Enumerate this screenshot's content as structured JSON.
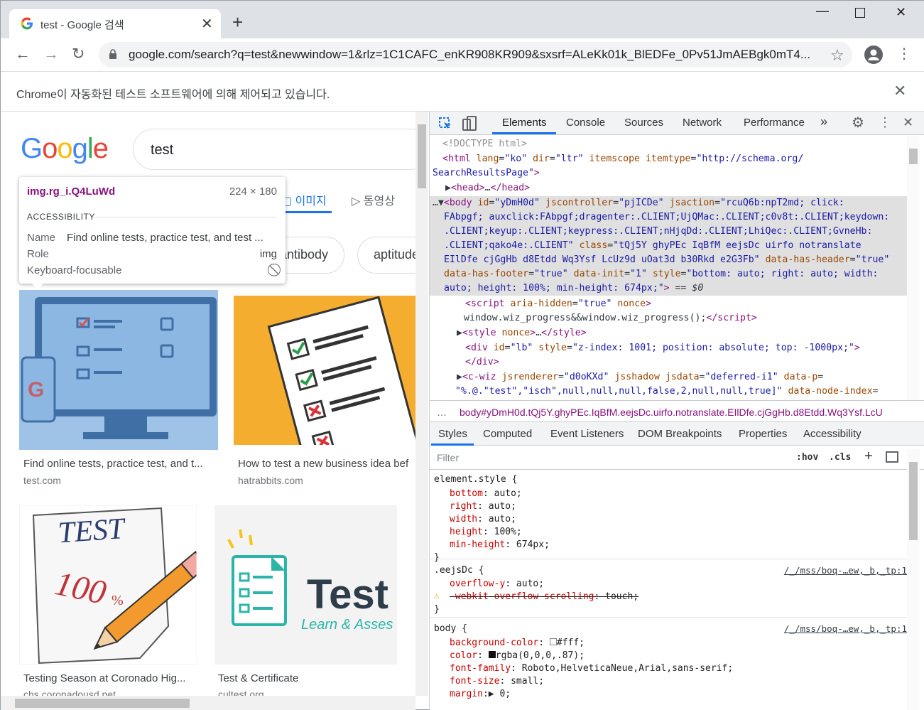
{
  "browser": {
    "tab_title": "test - Google 검색",
    "url": "google.com/search?q=test&newwindow=1&rlz=1C1CAFC_enKR908KR909&sxsrf=ALeKk01k_BlEDFe_0Pv51JmAEBgk0mT4...",
    "infobar_text": "Chrome이 자동화된 테스트 소프트웨어에 의해 제어되고 있습니다."
  },
  "page": {
    "logo_letters": [
      "G",
      "o",
      "o",
      "g",
      "l",
      "e"
    ],
    "logo_colors": [
      "#4285F4",
      "#EA4335",
      "#FBBC05",
      "#4285F4",
      "#34A853",
      "#EA4335"
    ],
    "search_query": "test",
    "tabs": {
      "images": "이미지",
      "videos": "동영상"
    },
    "chips": [
      "antibody",
      "aptitude"
    ],
    "results": [
      {
        "caption": "Find online tests, practice test, and t...",
        "domain": "test.com"
      },
      {
        "caption": "How to test a new business idea bef",
        "domain": "hatrabbits.com"
      },
      {
        "caption": "Testing Season at Coronado Hig...",
        "domain": "chs.coronadousd.net"
      },
      {
        "caption": "Test & Certificate",
        "domain": "cultest.org"
      }
    ],
    "test_card": {
      "title": "Test",
      "subtitle": "Learn & Asses"
    },
    "pencil_card": {
      "word": "TEST",
      "score": "100",
      "percent": "%"
    }
  },
  "tooltip": {
    "selector": "img.rg_i.Q4LuWd",
    "dimensions": "224 × 180",
    "section": "ACCESSIBILITY",
    "name_label": "Name",
    "name_value": "Find online tests, practice test, and test ...",
    "role_label": "Role",
    "role_value": "img",
    "focus_label": "Keyboard-focusable"
  },
  "devtools": {
    "tabs": [
      "Elements",
      "Console",
      "Sources",
      "Network",
      "Performance"
    ],
    "more": "»",
    "breadcrumb": "body#yDmH0d.tQj5Y.ghyPEc.IqBfM.eejsDc.uirfo.notranslate.EIlDfe.cjGgHb.d8Etdd.Wq3Ysf.LcU",
    "styles_tabs": [
      "Styles",
      "Computed",
      "Event Listeners",
      "DOM Breakpoints",
      "Properties",
      "Accessibility"
    ],
    "filter_placeholder": "Filter",
    "hov": ":hov",
    "cls": ".cls"
  },
  "colors": {
    "accent": "#1a73e8",
    "tag": "#881280",
    "attr": "#994500",
    "value": "#1a1aa6"
  }
}
